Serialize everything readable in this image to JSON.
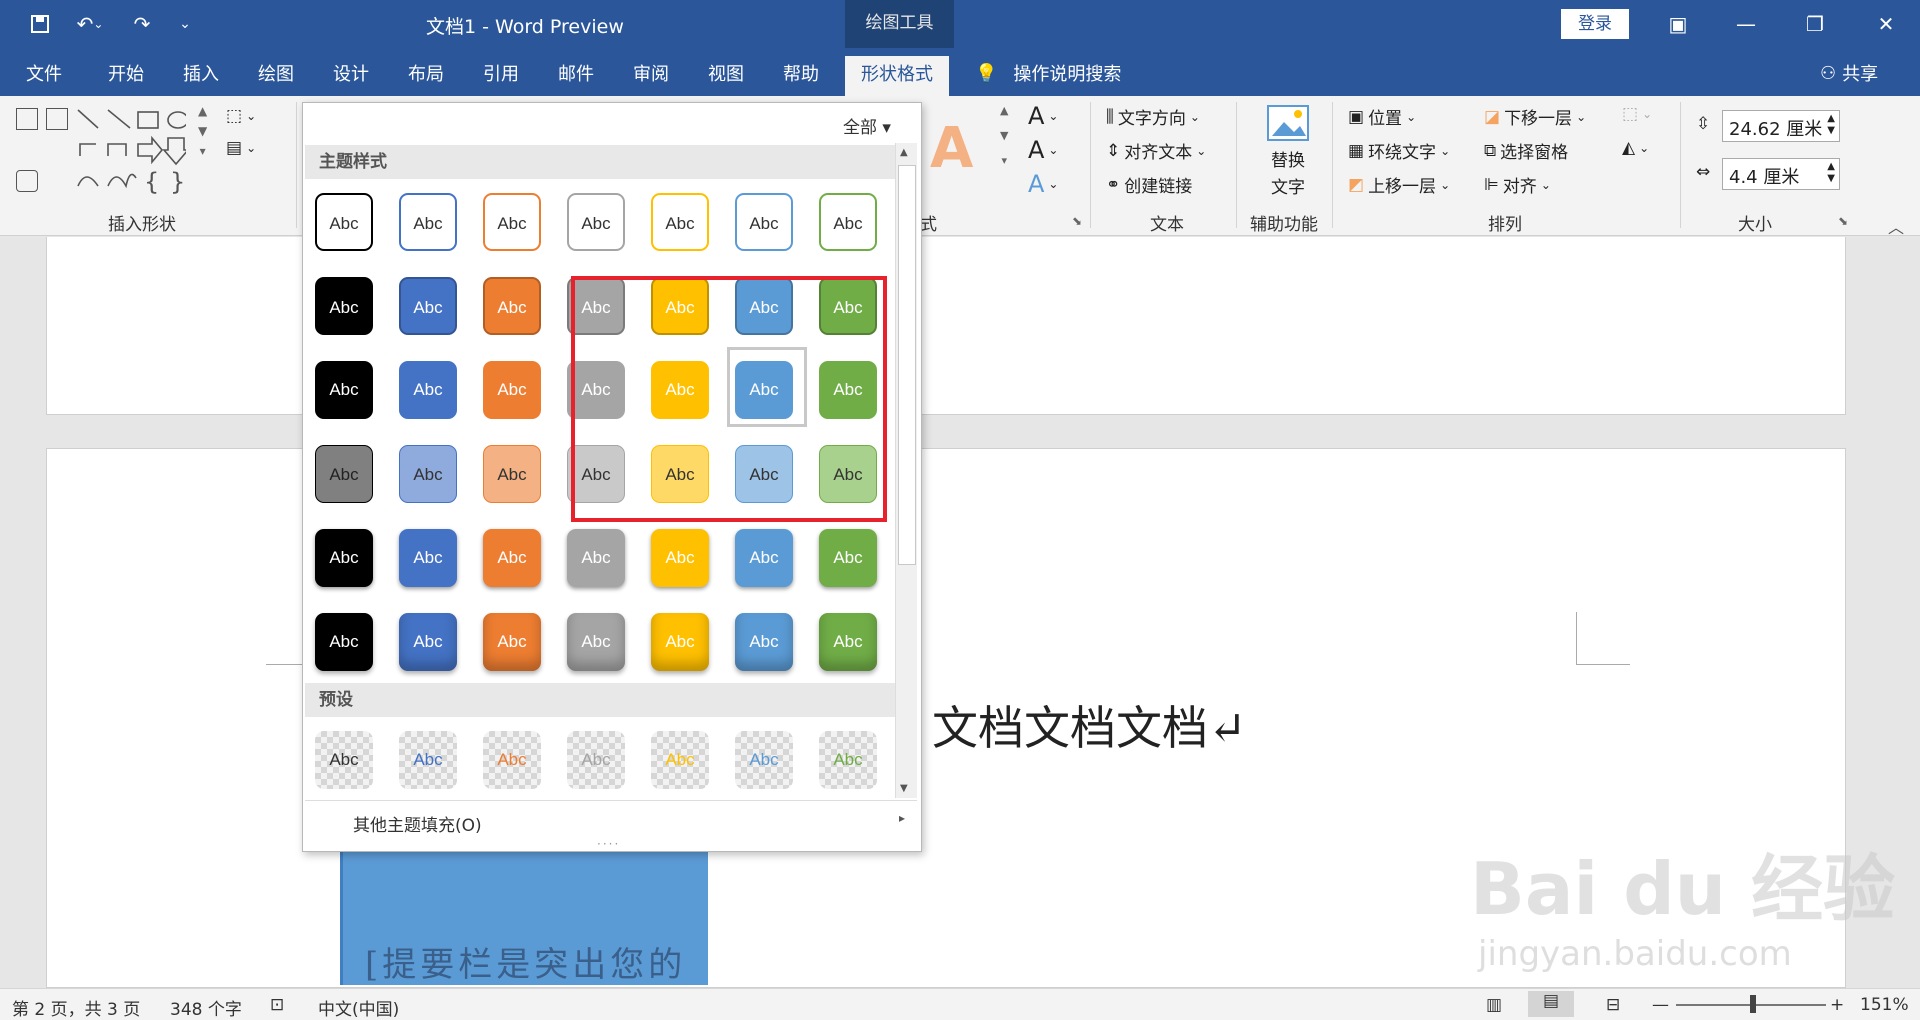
{
  "titlebar": {
    "save_icon": "save-icon",
    "undo_icon": "undo-icon",
    "redo_icon": "redo-icon",
    "doc_title": "文档1  -  Word Preview",
    "tools_tab": "绘图工具",
    "login": "登录"
  },
  "tabs": [
    "文件",
    "开始",
    "插入",
    "绘图",
    "设计",
    "布局",
    "引用",
    "邮件",
    "审阅",
    "视图",
    "帮助"
  ],
  "active_tab": "形状格式",
  "search": "操作说明搜索",
  "share": "共享",
  "ribbon": {
    "insert_shapes_label": "插入形状",
    "style_label_fragment": "式",
    "text_group": {
      "label": "文本",
      "text_direction": "文字方向",
      "align_text": "对齐文本",
      "create_link": "创建链接"
    },
    "accessibility": {
      "label": "辅助功能",
      "alt_text_line1": "替换",
      "alt_text_line2": "文字"
    },
    "arrange": {
      "label": "排列",
      "position": "位置",
      "wrap_text": "环绕文字",
      "bring_forward": "上移一层",
      "send_backward": "下移一层",
      "selection_pane": "选择窗格",
      "align": "对齐"
    },
    "size": {
      "label": "大小",
      "height": "24.62 厘米",
      "width": "4.4 厘米"
    }
  },
  "gallery": {
    "filter": "全部",
    "theme_styles_header": "主题样式",
    "presets_header": "预设",
    "swatch_text": "Abc",
    "more_fills": "其他主题填充(O)",
    "colors": [
      "#000000",
      "#4472c4",
      "#ed7d31",
      "#a5a5a5",
      "#ffc000",
      "#5b9bd5",
      "#70ad47"
    ],
    "light_colors": [
      "#808080",
      "#8faadc",
      "#f4b183",
      "#c9c9c9",
      "#ffd966",
      "#9dc3e6",
      "#a9d18e"
    ],
    "highlight_color": "#e8222c"
  },
  "document": {
    "body_text": "文档文档文档↵",
    "sidebar_text": "[提要栏是突出您的"
  },
  "status": {
    "page": "第 2 页，共 3 页",
    "words": "348 个字",
    "language": "中文(中国)",
    "zoom": "151%"
  },
  "watermark": {
    "brand": "Bai du 经验",
    "url": "jingyan.baidu.com"
  }
}
